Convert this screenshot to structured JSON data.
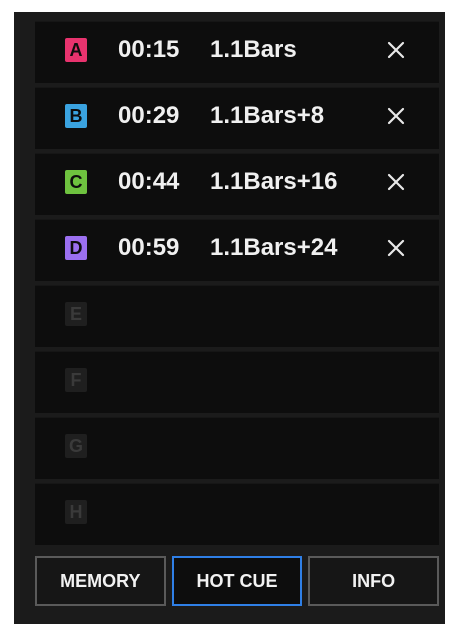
{
  "cues": [
    {
      "letter": "A",
      "time": "00:15",
      "position": "1.1Bars",
      "color": "#e8336e",
      "set": true
    },
    {
      "letter": "B",
      "time": "00:29",
      "position": "1.1Bars+8",
      "color": "#3aa3e0",
      "set": true
    },
    {
      "letter": "C",
      "time": "00:44",
      "position": "1.1Bars+16",
      "color": "#6ec23f",
      "set": true
    },
    {
      "letter": "D",
      "time": "00:59",
      "position": "1.1Bars+24",
      "color": "#9b6ff0",
      "set": true
    },
    {
      "letter": "E",
      "time": "",
      "position": "",
      "color": "#1f1f1f",
      "set": false
    },
    {
      "letter": "F",
      "time": "",
      "position": "",
      "color": "#1f1f1f",
      "set": false
    },
    {
      "letter": "G",
      "time": "",
      "position": "",
      "color": "#1f1f1f",
      "set": false
    },
    {
      "letter": "H",
      "time": "",
      "position": "",
      "color": "#1f1f1f",
      "set": false
    }
  ],
  "delete_icon": "close-icon",
  "tabs": [
    {
      "label": "MEMORY",
      "active": false
    },
    {
      "label": "HOT CUE",
      "active": true
    },
    {
      "label": "INFO",
      "active": false
    }
  ],
  "colors": {
    "panel_bg": "#1b1b1b",
    "row_bg": "#0d0d0d",
    "active_tab_border": "#2f7fe6"
  }
}
